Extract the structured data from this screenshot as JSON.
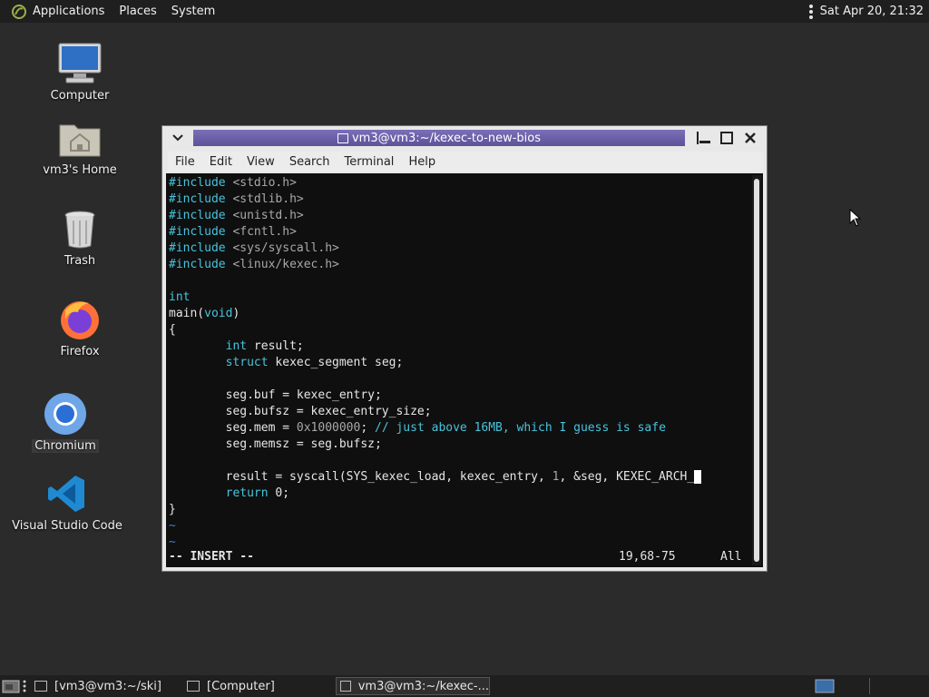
{
  "top_panel": {
    "menus": [
      "Applications",
      "Places",
      "System"
    ],
    "clock": "Sat Apr 20, 21:32"
  },
  "desktop_icons": [
    {
      "label": "Computer",
      "icon": "computer-icon"
    },
    {
      "label": "vm3's Home",
      "icon": "home-folder-icon"
    },
    {
      "label": "Trash",
      "icon": "trash-icon"
    },
    {
      "label": "Firefox",
      "icon": "firefox-icon"
    },
    {
      "label": "Chromium",
      "icon": "chromium-icon"
    },
    {
      "label": "Visual Studio Code",
      "icon": "vscode-icon"
    }
  ],
  "terminal": {
    "title": "vm3@vm3:~/kexec-to-new-bios",
    "menu": [
      "File",
      "Edit",
      "View",
      "Search",
      "Terminal",
      "Help"
    ],
    "code_lines": [
      "#include <stdio.h>",
      "#include <stdlib.h>",
      "#include <unistd.h>",
      "#include <fcntl.h>",
      "#include <sys/syscall.h>",
      "#include <linux/kexec.h>",
      "",
      "int",
      "main(void)",
      "{",
      "        int result;",
      "        struct kexec_segment seg;",
      "",
      "        seg.buf = kexec_entry;",
      "        seg.bufsz = kexec_entry_size;",
      "        seg.mem = 0x1000000; // just above 16MB, which I guess is safe",
      "        seg.memsz = seg.bufsz;",
      "",
      "        result = syscall(SYS_kexec_load, kexec_entry, 1, &seg, KEXEC_ARCH_",
      "        return 0;",
      "}",
      "~",
      "~"
    ],
    "status": {
      "mode": "-- INSERT --",
      "position": "19,68-75",
      "scope": "All"
    }
  },
  "taskbar": {
    "items": [
      {
        "label": "[vm3@vm3:~/ski]",
        "active": false
      },
      {
        "label": "[Computer]",
        "active": false
      },
      {
        "label": "vm3@vm3:~/kexec-...",
        "active": true
      }
    ]
  },
  "colors": {
    "desktop_bg": "#2b2b2b",
    "panel_bg": "#1f1f1f",
    "title_bar": "#6a5fa8",
    "keyword": "#47c4dc",
    "comment": "#47c4dc"
  }
}
